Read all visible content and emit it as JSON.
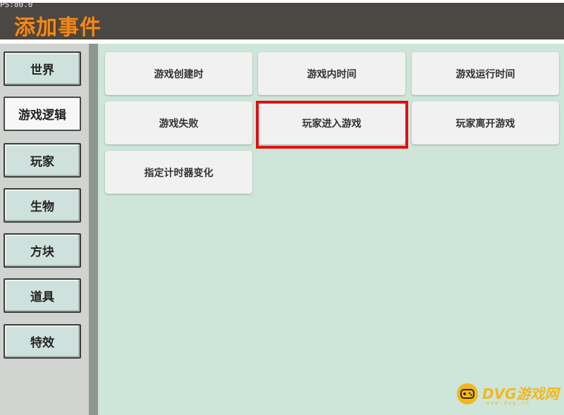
{
  "overlay": {
    "fps": "PS:80.0"
  },
  "header": {
    "title": "添加事件"
  },
  "sidebar": {
    "items": [
      {
        "label": "世界",
        "active": false
      },
      {
        "label": "游戏逻辑",
        "active": true
      },
      {
        "label": "玩家",
        "active": false
      },
      {
        "label": "生物",
        "active": false
      },
      {
        "label": "方块",
        "active": false
      },
      {
        "label": "道具",
        "active": false
      },
      {
        "label": "特效",
        "active": false
      }
    ]
  },
  "events": [
    {
      "label": "游戏创建时"
    },
    {
      "label": "游戏内时间"
    },
    {
      "label": "游戏运行时间"
    },
    {
      "label": "游戏失败"
    },
    {
      "label": "玩家进入游戏",
      "highlighted": true
    },
    {
      "label": "玩家离开游戏"
    },
    {
      "label": "指定计时器变化"
    }
  ],
  "watermark": {
    "text": "DVG游戏网",
    "subtext": "www.dvg.cn"
  },
  "colors": {
    "title": "#f08a1c",
    "topbar": "#4b4743",
    "main_bg": "#cde6d9",
    "highlight": "#e20f12",
    "watermark": "#f2b71e"
  }
}
